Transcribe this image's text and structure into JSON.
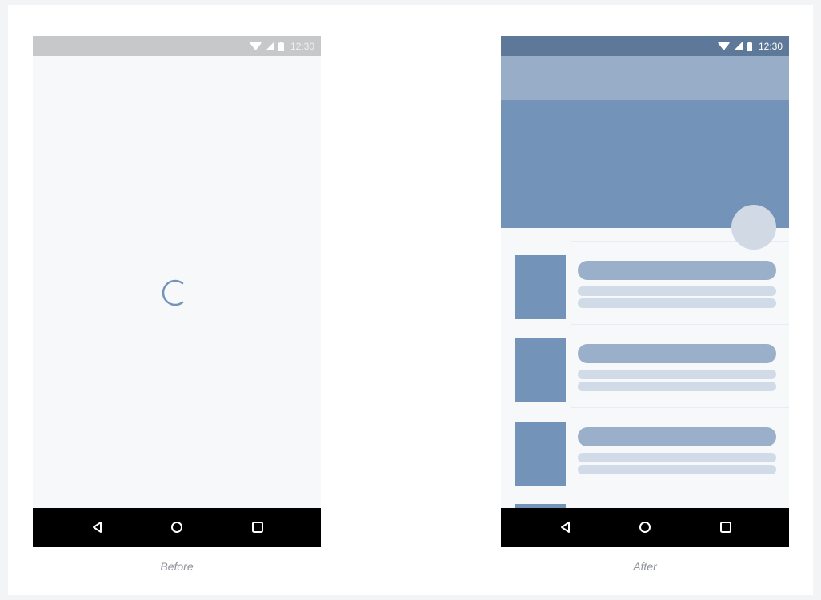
{
  "before": {
    "status_bar": {
      "time": "12:30",
      "icons": [
        "wifi-icon",
        "cell-signal-icon",
        "battery-icon"
      ]
    },
    "loading_indicator": "spinner-icon",
    "nav_bar": {
      "buttons": [
        "back-icon",
        "home-icon",
        "recents-icon"
      ]
    },
    "caption": "Before"
  },
  "after": {
    "status_bar": {
      "time": "12:30",
      "icons": [
        "wifi-icon",
        "cell-signal-icon",
        "battery-icon"
      ]
    },
    "list": {
      "placeholder_items": 3
    },
    "nav_bar": {
      "buttons": [
        "back-icon",
        "home-icon",
        "recents-icon"
      ]
    },
    "caption": "After"
  },
  "colors": {
    "background": "#f3f4f5",
    "phone_surface": "#f6f8fa",
    "before_status_bar": "#c6c8ca",
    "after_status_bar": "#5e7899",
    "app_bar": "#98aec8",
    "hero": "#7393b9",
    "accent_circle": "#d1d9e5",
    "placeholder_thumb": "#7393b9",
    "placeholder_title": "#99afca",
    "placeholder_line": "#d1dbe7",
    "nav_bar": "#000000",
    "caption_text": "#8d9198"
  }
}
